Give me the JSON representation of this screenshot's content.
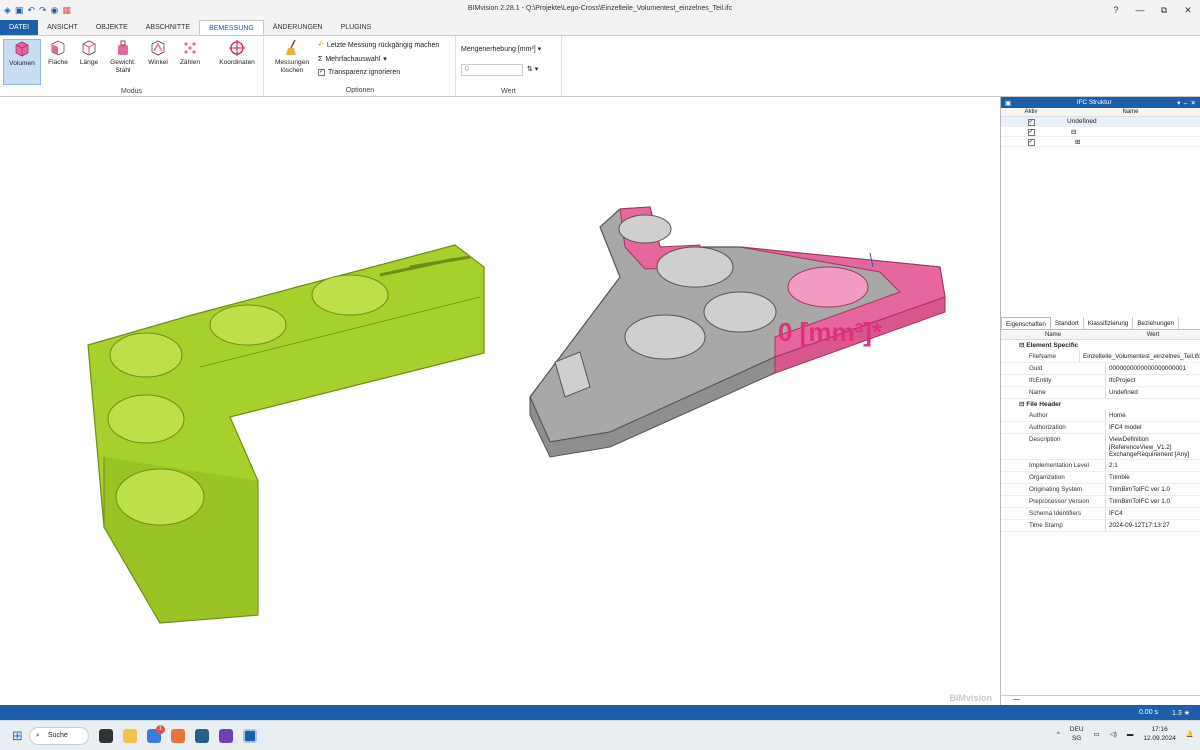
{
  "app": {
    "title": "BIMvision 2.28.1 - Q:\\Projekte\\Lego-Cross\\Einzelteile_Volumentest_einzelnes_Teil.ifc"
  },
  "window_controls": {
    "help": "?",
    "min": "—",
    "restore": "⧉",
    "close": "✕"
  },
  "tabs": [
    "DATEI",
    "ANSICHT",
    "OBJEKTE",
    "ABSCHNITTE",
    "BEMESSUNG",
    "ÄNDERUNGEN",
    "PLUGINS"
  ],
  "ribbon": {
    "modus_buttons": [
      "Volumen",
      "Fläche",
      "Länge",
      "Gewicht: Stahl",
      "Winkel",
      "Zählen"
    ],
    "koordinaten": "Koordinaten",
    "modus_caption": "Modus",
    "loeschen": "Messungen löschen",
    "opt_undo": "Letzte Messung rückgängig machen",
    "opt_multi": "Mehrfachauswahl",
    "opt_transp": "Transparenz ignorieren",
    "optionen_caption": "Optionen",
    "menge_label": "Mengenerhebung  [mm³]",
    "menge_value": "0",
    "wert_caption": "Wert"
  },
  "viewport": {
    "measurement": "0 [mm³]*",
    "watermark": "BIMvision"
  },
  "ifc_panel": {
    "title": "IFC Struktur",
    "col_active": "Aktiv",
    "col_name": "Name",
    "rows": [
      {
        "name": "Undefined"
      },
      {
        "name": ""
      },
      {
        "name": ""
      }
    ]
  },
  "props_tabs": [
    "Eigenschaften",
    "Standort",
    "Klassifizierung",
    "Beziehungen"
  ],
  "props_cols": {
    "name": "Name",
    "value": "Wert"
  },
  "props": {
    "sect1": "Element Specific",
    "rows1": [
      {
        "k": "FileName",
        "v": "Einzelteile_Volumentest_einzelnes_Teil.ifc"
      },
      {
        "k": "Guid",
        "v": "0000000000000000000001"
      },
      {
        "k": "IfcEntity",
        "v": "IfcProject"
      },
      {
        "k": "Name",
        "v": "Undefined"
      }
    ],
    "sect2": "File Header",
    "rows2": [
      {
        "k": "Author",
        "v": "Home"
      },
      {
        "k": "Authorization",
        "v": "IFC4 model"
      },
      {
        "k": "Description",
        "v": "ViewDefinition [ReferenceView_V1.2] ExchangeRequirement [Any]"
      },
      {
        "k": "Implementation Level",
        "v": "2;1"
      },
      {
        "k": "Organization",
        "v": "Trimble"
      },
      {
        "k": "Originating System",
        "v": "TrimBimToIFC ver 1.0"
      },
      {
        "k": "Preprocessor Version",
        "v": "TrimBimToIFC ver 1.0"
      },
      {
        "k": "Schema Identifiers",
        "v": "IFC4"
      },
      {
        "k": "Time Stamp",
        "v": "2024-09-12T17:13:27"
      }
    ]
  },
  "status": {
    "time": "0.00 s",
    "zoom": "1.3 ★"
  },
  "taskbar": {
    "search": "Suche",
    "lang": "DEU",
    "region": "SG",
    "clock": "17:16",
    "date": "12.09.2024",
    "badge": "1"
  },
  "colors": {
    "accent": "#1d5ea8",
    "green_part": "#a6d12c",
    "pink": "#e6679e",
    "gray_part": "#9a9a9a"
  }
}
